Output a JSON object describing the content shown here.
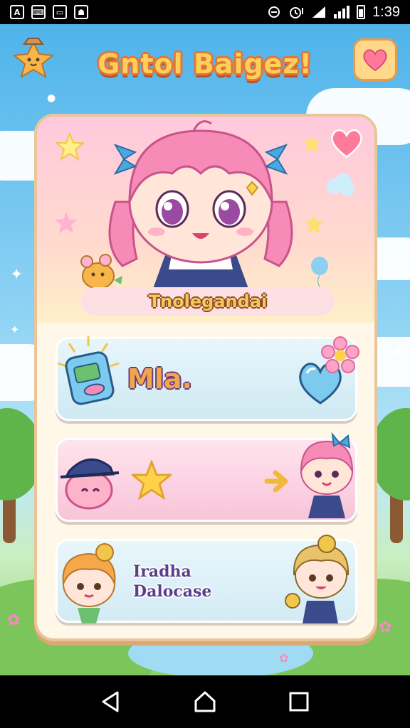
{
  "status_bar": {
    "time": "1:39",
    "left_icons": [
      "a-icon",
      "keyboard-icon",
      "square-icon",
      "photo-icon"
    ],
    "right_icons": [
      "vibrate-icon",
      "alarm-icon",
      "wifi-icon",
      "signal-icon",
      "battery-icon"
    ]
  },
  "header": {
    "title": "Gntol Baigez!"
  },
  "hero": {
    "name": "Tnolegandai"
  },
  "rows": [
    {
      "label": "Mla."
    },
    {
      "label": ""
    },
    {
      "line1": "Iradha",
      "line2": "Dalocase"
    }
  ],
  "colors": {
    "sky": "#4fb3ea",
    "card": "#fff7e8",
    "card_border": "#e9c59a",
    "title_fill": "#ffcf5a",
    "title_outline": "#e0763a",
    "row_blue": "#cfe9f3",
    "row_pink": "#f8c4d8",
    "hair_pink": "#f78bb8"
  },
  "nav": [
    "back-icon",
    "home-icon",
    "recents-icon"
  ]
}
